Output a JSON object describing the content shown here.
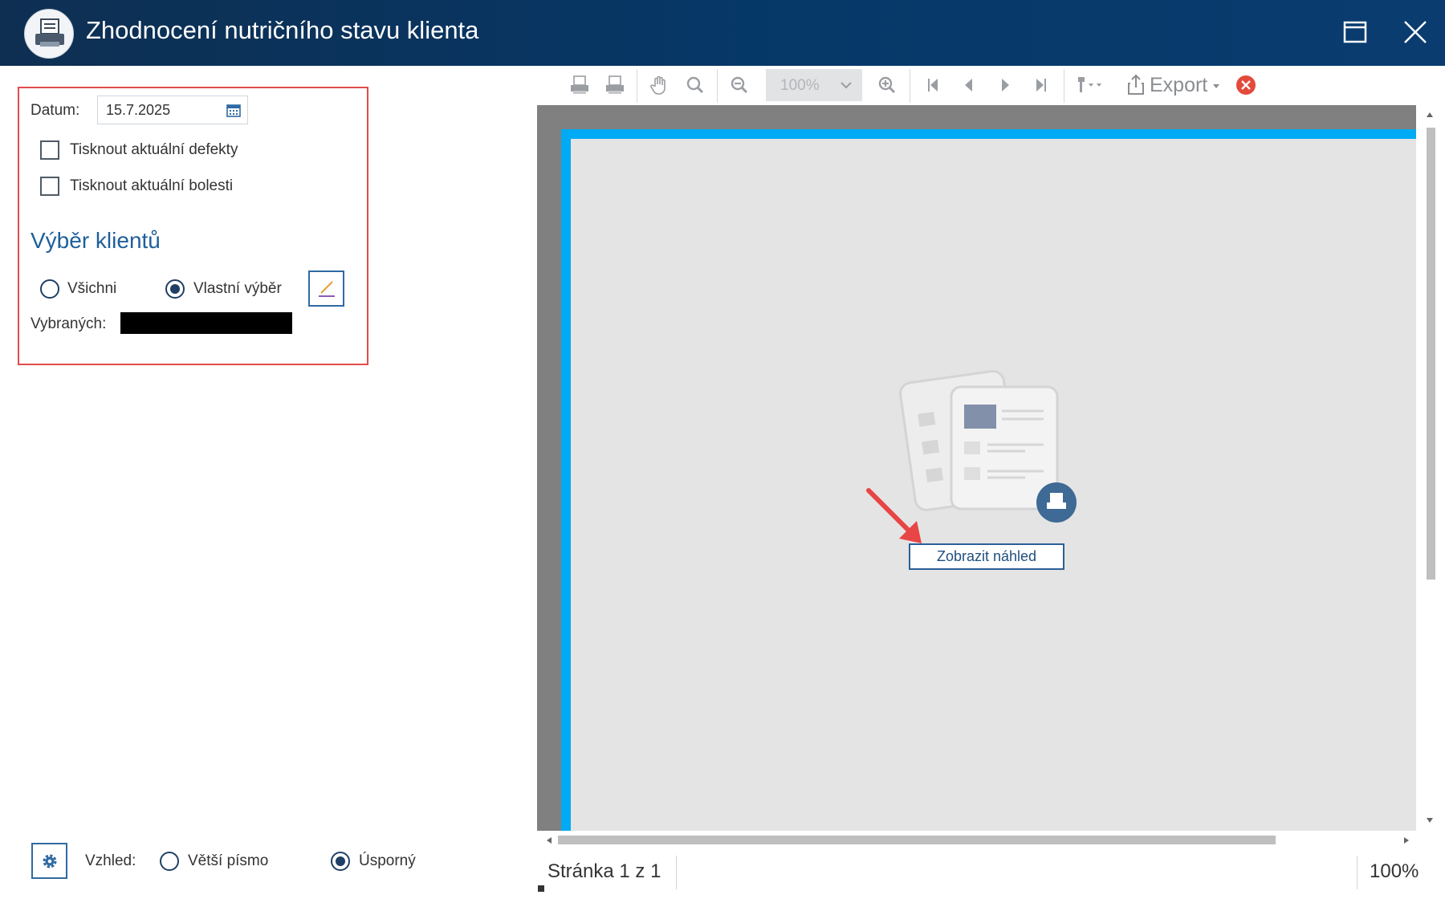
{
  "window": {
    "title": "Zhodnocení nutričního stavu klienta",
    "icon": "printer-icon"
  },
  "params": {
    "date_label": "Datum:",
    "date_value": "15.7.2025",
    "print_defects_label": "Tisknout aktuální defekty",
    "print_defects_checked": false,
    "print_pains_label": "Tisknout aktuální bolesti",
    "print_pains_checked": false
  },
  "client_selection": {
    "heading": "Výběr klientů",
    "options": [
      {
        "label": "Všichni",
        "selected": false
      },
      {
        "label": "Vlastní výběr",
        "selected": true
      }
    ],
    "selected_label": "Vybraných:",
    "selected_value_redacted": true
  },
  "appearance": {
    "label": "Vzhled:",
    "options": [
      {
        "label": "Větší písmo",
        "selected": false
      },
      {
        "label": "Úsporný",
        "selected": true
      }
    ]
  },
  "toolbar": {
    "zoom_value": "100%",
    "export_label": "Export",
    "icons": [
      "print-icon",
      "quick-print-icon",
      "hand-tool-icon",
      "search-icon",
      "zoom-out-icon",
      "zoom-in-icon",
      "first-page-icon",
      "prev-page-icon",
      "next-page-icon",
      "last-page-icon",
      "page-setup-icon",
      "export-icon",
      "cancel-icon"
    ]
  },
  "preview": {
    "button_label": "Zobrazit náhled"
  },
  "status": {
    "page_text": "Stránka 1 z 1",
    "zoom_text": "100%"
  },
  "colors": {
    "titlebar": "#063868",
    "accent": "#1f5f9a",
    "page_border": "#00aaf5",
    "highlight_frame": "#e24c4c",
    "cancel": "#e34a3c"
  }
}
